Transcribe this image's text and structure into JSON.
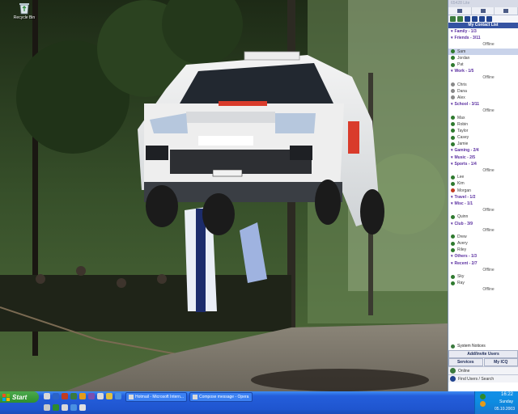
{
  "desktop": {
    "icon_label": "Recycle Bin"
  },
  "contact_list": {
    "window_title": "65428 Lite",
    "title": "My Contact List",
    "rows": [
      {
        "type": "group",
        "label": "Family - 1/3"
      },
      {
        "type": "group",
        "label": "Friends - 3/11"
      },
      {
        "type": "sep",
        "label": "Offline"
      },
      {
        "type": "contact",
        "label": "Sam",
        "color": "#2f7a2f",
        "selected": true
      },
      {
        "type": "contact",
        "label": "Jordan",
        "color": "#2f7a2f"
      },
      {
        "type": "contact",
        "label": "Pat",
        "color": "#2f7a2f"
      },
      {
        "type": "group",
        "label": "Work - 1/5"
      },
      {
        "type": "sep",
        "label": "Offline"
      },
      {
        "type": "contact",
        "label": "Chris",
        "color": "#888888"
      },
      {
        "type": "contact",
        "label": "Dana",
        "color": "#888888"
      },
      {
        "type": "contact",
        "label": "Alex",
        "color": "#888888"
      },
      {
        "type": "group",
        "label": "School - 3/11"
      },
      {
        "type": "sep",
        "label": "Offline"
      },
      {
        "type": "contact",
        "label": "Max",
        "color": "#2f7a2f"
      },
      {
        "type": "contact",
        "label": "Robin",
        "color": "#2f7a2f"
      },
      {
        "type": "contact",
        "label": "Taylor",
        "color": "#2f7a2f"
      },
      {
        "type": "contact",
        "label": "Casey",
        "color": "#2f7a2f"
      },
      {
        "type": "contact",
        "label": "Jamie",
        "color": "#2f7a2f"
      },
      {
        "type": "group",
        "label": "Gaming - 2/4"
      },
      {
        "type": "group",
        "label": "Music - 2/5"
      },
      {
        "type": "group",
        "label": "Sports - 1/4"
      },
      {
        "type": "sep",
        "label": "Offline"
      },
      {
        "type": "contact",
        "label": "Lee",
        "color": "#2f7a2f"
      },
      {
        "type": "contact",
        "label": "Kim",
        "color": "#2f7a2f"
      },
      {
        "type": "contact",
        "label": "Morgan",
        "color": "#c23b22"
      },
      {
        "type": "group",
        "label": "Travel - 1/2"
      },
      {
        "type": "group",
        "label": "Misc - 1/1"
      },
      {
        "type": "sep",
        "label": "Offline"
      },
      {
        "type": "contact",
        "label": "Quinn",
        "color": "#2f7a2f"
      },
      {
        "type": "group",
        "label": "Club - 3/9"
      },
      {
        "type": "sep",
        "label": "Offline"
      },
      {
        "type": "contact",
        "label": "Drew",
        "color": "#2f7a2f"
      },
      {
        "type": "contact",
        "label": "Avery",
        "color": "#2f7a2f"
      },
      {
        "type": "contact",
        "label": "Riley",
        "color": "#2f7a2f"
      },
      {
        "type": "group",
        "label": "Others - 1/3"
      },
      {
        "type": "group",
        "label": "Recent - 2/7"
      },
      {
        "type": "sep",
        "label": "Offline"
      },
      {
        "type": "contact",
        "label": "Sky",
        "color": "#2f7a2f"
      },
      {
        "type": "contact",
        "label": "Ray",
        "color": "#2f7a2f"
      },
      {
        "type": "sep",
        "label": "Offline"
      }
    ],
    "system_notices": "System Notices",
    "add_invite": "Add/Invite Users",
    "services": "Services",
    "my_icq": "My ICQ",
    "status_text": "Online",
    "search_label": "Find Users / Search"
  },
  "taskbar": {
    "start_label": "Start",
    "tasks": [
      {
        "label": "Hotmail - Microsoft Intern..."
      },
      {
        "label": "Compose message - Opera"
      }
    ],
    "clock": "16:22",
    "day": "Sunday",
    "date": "05.10.2003"
  }
}
